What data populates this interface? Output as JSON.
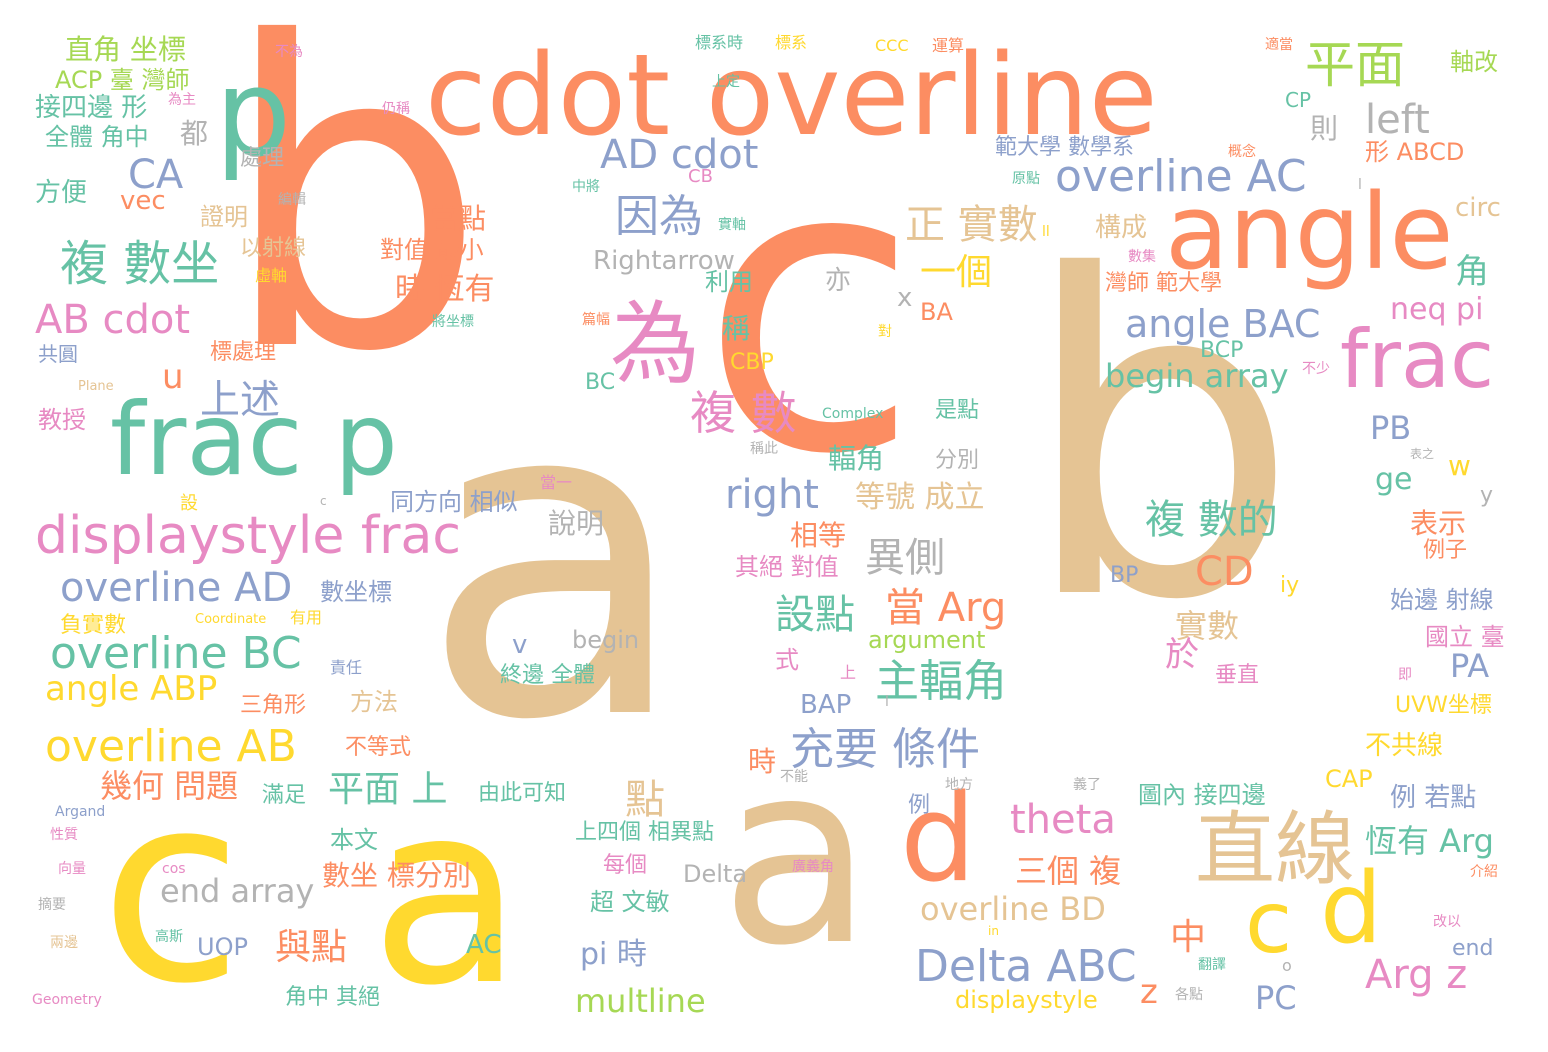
{
  "palette": {
    "orange": "#fc8d62",
    "tan": "#e5c494",
    "yellow": "#ffd92f",
    "green": "#66c2a5",
    "blue": "#8da0cb",
    "pink": "#e78ac3",
    "lime": "#a6d854",
    "gray": "#b3b3b3"
  },
  "words": [
    {
      "text": "b",
      "color": "orange"
    },
    {
      "text": "c",
      "color": "orange"
    },
    {
      "text": "a",
      "color": "tan"
    },
    {
      "text": "b",
      "color": "tan"
    },
    {
      "text": "a",
      "color": "yellow"
    },
    {
      "text": "c",
      "color": "yellow"
    },
    {
      "text": "a",
      "color": "tan"
    },
    {
      "text": "d",
      "color": "orange"
    },
    {
      "text": "c",
      "color": "yellow"
    },
    {
      "text": "d",
      "color": "yellow"
    },
    {
      "text": "p",
      "color": "green"
    },
    {
      "text": "cdot overline",
      "color": "orange"
    },
    {
      "text": "angle",
      "color": "orange"
    },
    {
      "text": "frac p",
      "color": "green"
    },
    {
      "text": "frac",
      "color": "pink"
    },
    {
      "text": "直線",
      "color": "tan"
    },
    {
      "text": "為",
      "color": "pink"
    },
    {
      "text": "displaystyle frac",
      "color": "pink"
    },
    {
      "text": "平面",
      "color": "lime"
    },
    {
      "text": "left",
      "color": "gray"
    },
    {
      "text": "overline AC",
      "color": "blue"
    },
    {
      "text": "AD cdot",
      "color": "blue"
    },
    {
      "text": "複 數坐",
      "color": "green"
    },
    {
      "text": "因為",
      "color": "blue"
    },
    {
      "text": "正 實數",
      "color": "tan"
    },
    {
      "text": "一個",
      "color": "yellow"
    },
    {
      "text": "AB cdot",
      "color": "pink"
    },
    {
      "text": "CA",
      "color": "blue"
    },
    {
      "text": "overline AD",
      "color": "blue"
    },
    {
      "text": "overline BC",
      "color": "green"
    },
    {
      "text": "angle ABP",
      "color": "yellow"
    },
    {
      "text": "overline AB",
      "color": "yellow"
    },
    {
      "text": "複 數",
      "color": "pink"
    },
    {
      "text": "right",
      "color": "blue"
    },
    {
      "text": "上述",
      "color": "blue"
    },
    {
      "text": "angle BAC",
      "color": "blue"
    },
    {
      "text": "begin array",
      "color": "green"
    },
    {
      "text": "複 數的",
      "color": "green"
    },
    {
      "text": "CD",
      "color": "orange"
    },
    {
      "text": "異側",
      "color": "gray"
    },
    {
      "text": "當 Arg",
      "color": "orange"
    },
    {
      "text": "設點",
      "color": "green"
    },
    {
      "text": "主輻角",
      "color": "green"
    },
    {
      "text": "充要 條件",
      "color": "blue"
    },
    {
      "text": "theta",
      "color": "pink"
    },
    {
      "text": "Delta ABC",
      "color": "blue"
    },
    {
      "text": "Arg z",
      "color": "pink"
    },
    {
      "text": "overline BD",
      "color": "tan"
    },
    {
      "text": "三個 複",
      "color": "orange"
    },
    {
      "text": "平面 上",
      "color": "green"
    },
    {
      "text": "幾何 問題",
      "color": "orange"
    },
    {
      "text": "end array",
      "color": "gray"
    },
    {
      "text": "與點",
      "color": "orange"
    },
    {
      "text": "multline",
      "color": "lime"
    },
    {
      "text": "pi 時",
      "color": "blue"
    },
    {
      "text": "點",
      "color": "tan"
    },
    {
      "text": "中",
      "color": "orange"
    },
    {
      "text": "z",
      "color": "orange"
    },
    {
      "text": "PC",
      "color": "blue"
    },
    {
      "text": "恆有 Arg",
      "color": "green"
    },
    {
      "text": "例 若點",
      "color": "blue"
    },
    {
      "text": "PA",
      "color": "blue"
    },
    {
      "text": "PB",
      "color": "blue"
    },
    {
      "text": "ge",
      "color": "green"
    },
    {
      "text": "w",
      "color": "yellow"
    },
    {
      "text": "Rightarrow",
      "color": "gray"
    },
    {
      "text": "時 恆有",
      "color": "orange"
    },
    {
      "text": "當點",
      "color": "orange"
    },
    {
      "text": "對值 最小",
      "color": "orange"
    },
    {
      "text": "等號 成立",
      "color": "tan"
    },
    {
      "text": "輻角",
      "color": "green"
    },
    {
      "text": "直角 坐標",
      "color": "lime"
    },
    {
      "text": "ACP 臺 灣師",
      "color": "lime"
    },
    {
      "text": "接四邊 形",
      "color": "green"
    },
    {
      "text": "全體 角中",
      "color": "green"
    },
    {
      "text": "都",
      "color": "gray"
    },
    {
      "text": "方便",
      "color": "green"
    },
    {
      "text": "vec",
      "color": "orange"
    },
    {
      "text": "處理",
      "color": "gray"
    },
    {
      "text": "證明",
      "color": "tan"
    },
    {
      "text": "以射線",
      "color": "tan"
    },
    {
      "text": "u",
      "color": "orange"
    },
    {
      "text": "範大學 數學系",
      "color": "blue"
    },
    {
      "text": "則",
      "color": "gray"
    },
    {
      "text": "形 ABCD",
      "color": "orange"
    },
    {
      "text": "circ",
      "color": "tan"
    },
    {
      "text": "構成",
      "color": "tan"
    },
    {
      "text": "角",
      "color": "green"
    },
    {
      "text": "灣師 範大學",
      "color": "orange"
    },
    {
      "text": "neq pi",
      "color": "pink"
    },
    {
      "text": "軸改",
      "color": "lime"
    },
    {
      "text": "CP",
      "color": "green"
    },
    {
      "text": "BCP",
      "color": "green"
    },
    {
      "text": "亦",
      "color": "gray"
    },
    {
      "text": "x",
      "color": "gray"
    },
    {
      "text": "BA",
      "color": "orange"
    },
    {
      "text": "稱",
      "color": "green"
    },
    {
      "text": "利用",
      "color": "green"
    },
    {
      "text": "CBP",
      "color": "yellow"
    },
    {
      "text": "BC",
      "color": "green"
    },
    {
      "text": "是點",
      "color": "green"
    },
    {
      "text": "分別",
      "color": "gray"
    },
    {
      "text": "同方向 相似",
      "color": "blue"
    },
    {
      "text": "說明",
      "color": "gray"
    },
    {
      "text": "相等",
      "color": "orange"
    },
    {
      "text": "其絕 對值",
      "color": "pink"
    },
    {
      "text": "數坐標",
      "color": "blue"
    },
    {
      "text": "BP",
      "color": "blue"
    },
    {
      "text": "iy",
      "color": "yellow"
    },
    {
      "text": "始邊 射線",
      "color": "blue"
    },
    {
      "text": "國立 臺",
      "color": "pink"
    },
    {
      "text": "表示",
      "color": "orange"
    },
    {
      "text": "例子",
      "color": "orange"
    },
    {
      "text": "y",
      "color": "gray"
    },
    {
      "text": "實數",
      "color": "tan"
    },
    {
      "text": "於",
      "color": "pink"
    },
    {
      "text": "垂直",
      "color": "pink"
    },
    {
      "text": "argument",
      "color": "lime"
    },
    {
      "text": "begin",
      "color": "gray"
    },
    {
      "text": "v",
      "color": "blue"
    },
    {
      "text": "式",
      "color": "pink"
    },
    {
      "text": "終邊 全體",
      "color": "green"
    },
    {
      "text": "BAP",
      "color": "blue"
    },
    {
      "text": "方法",
      "color": "tan"
    },
    {
      "text": "三角形",
      "color": "orange"
    },
    {
      "text": "不等式",
      "color": "orange"
    },
    {
      "text": "滿足",
      "color": "green"
    },
    {
      "text": "由此可知",
      "color": "green"
    },
    {
      "text": "本文",
      "color": "green"
    },
    {
      "text": "數坐 標分別",
      "color": "orange"
    },
    {
      "text": "上四個 相異點",
      "color": "green"
    },
    {
      "text": "每個",
      "color": "pink"
    },
    {
      "text": "超 文敏",
      "color": "green"
    },
    {
      "text": "Delta",
      "color": "gray"
    },
    {
      "text": "AC",
      "color": "green"
    },
    {
      "text": "UOP",
      "color": "blue"
    },
    {
      "text": "角中 其絕",
      "color": "green"
    },
    {
      "text": "displaystyle",
      "color": "yellow"
    },
    {
      "text": "時",
      "color": "orange"
    },
    {
      "text": "圖內 接四邊",
      "color": "green"
    },
    {
      "text": "不共線",
      "color": "yellow"
    },
    {
      "text": "CAP",
      "color": "yellow"
    },
    {
      "text": "UVW坐標",
      "color": "yellow"
    },
    {
      "text": "end",
      "color": "blue"
    },
    {
      "text": "負實數",
      "color": "yellow"
    },
    {
      "text": "有用",
      "color": "yellow"
    },
    {
      "text": "Coordinate",
      "color": "yellow"
    },
    {
      "text": "教授",
      "color": "pink"
    },
    {
      "text": "共圓",
      "color": "blue"
    },
    {
      "text": "標處理",
      "color": "orange"
    },
    {
      "text": "虛軸",
      "color": "yellow"
    },
    {
      "text": "責任",
      "color": "blue"
    },
    {
      "text": "Plane",
      "color": "tan"
    },
    {
      "text": "Complex",
      "color": "green"
    },
    {
      "text": "Argand",
      "color": "blue"
    },
    {
      "text": "性質",
      "color": "pink"
    },
    {
      "text": "向量",
      "color": "pink"
    },
    {
      "text": "摘要",
      "color": "gray"
    },
    {
      "text": "兩邊",
      "color": "tan"
    },
    {
      "text": "Geometry",
      "color": "pink"
    },
    {
      "text": "高斯",
      "color": "green"
    },
    {
      "text": "cos",
      "color": "pink"
    },
    {
      "text": "c",
      "color": "gray"
    },
    {
      "text": "設",
      "color": "yellow"
    },
    {
      "text": "當一",
      "color": "pink"
    },
    {
      "text": "稱此",
      "color": "gray"
    },
    {
      "text": "上",
      "color": "pink"
    },
    {
      "text": "不能",
      "color": "gray"
    },
    {
      "text": "地方",
      "color": "gray"
    },
    {
      "text": "例",
      "color": "blue"
    },
    {
      "text": "廣義角",
      "color": "pink"
    },
    {
      "text": "義了",
      "color": "gray"
    },
    {
      "text": "各點",
      "color": "gray"
    },
    {
      "text": "in",
      "color": "yellow"
    },
    {
      "text": "翻譯",
      "color": "green"
    },
    {
      "text": "o",
      "color": "gray"
    },
    {
      "text": "表之",
      "color": "gray"
    },
    {
      "text": "即",
      "color": "pink"
    },
    {
      "text": "介紹",
      "color": "orange"
    },
    {
      "text": "改以",
      "color": "pink"
    },
    {
      "text": "不少",
      "color": "pink"
    },
    {
      "text": "對",
      "color": "yellow"
    },
    {
      "text": "將坐標",
      "color": "green"
    },
    {
      "text": "篇幅",
      "color": "orange"
    },
    {
      "text": "實軸",
      "color": "green"
    },
    {
      "text": "中將",
      "color": "green"
    },
    {
      "text": "CB",
      "color": "pink"
    },
    {
      "text": "編輯",
      "color": "gray"
    },
    {
      "text": "仍稱",
      "color": "pink"
    },
    {
      "text": "為主",
      "color": "pink"
    },
    {
      "text": "不為",
      "color": "pink"
    },
    {
      "text": "標系時",
      "color": "green"
    },
    {
      "text": "標系",
      "color": "yellow"
    },
    {
      "text": "上定",
      "color": "green"
    },
    {
      "text": "CCC",
      "color": "yellow"
    },
    {
      "text": "運算",
      "color": "orange"
    },
    {
      "text": "原點",
      "color": "green"
    },
    {
      "text": "概念",
      "color": "orange"
    },
    {
      "text": "適當",
      "color": "orange"
    },
    {
      "text": "數集",
      "color": "pink"
    },
    {
      "text": "ll",
      "color": "yellow"
    },
    {
      "text": "l",
      "color": "gray"
    },
    {
      "text": "l",
      "color": "gray"
    }
  ]
}
